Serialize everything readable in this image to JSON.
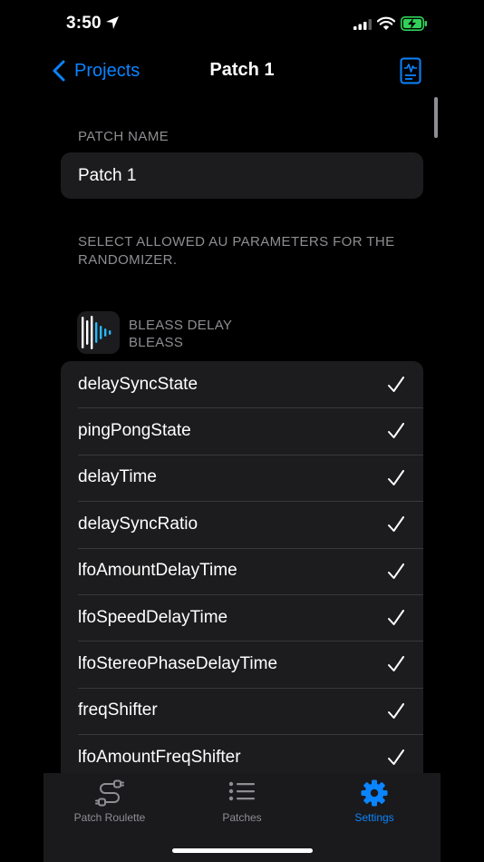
{
  "status_bar": {
    "time": "3:50"
  },
  "nav": {
    "back_label": "Projects",
    "title": "Patch 1"
  },
  "patch_name_section": {
    "header": "PATCH NAME",
    "value": "Patch 1"
  },
  "randomizer_section": {
    "header": "SELECT ALLOWED AU PARAMETERS FOR THE RANDOMIZER."
  },
  "plugin": {
    "name": "BLEASS DELAY",
    "vendor": "BLEASS"
  },
  "parameters": [
    {
      "label": "delaySyncState",
      "checked": true
    },
    {
      "label": "pingPongState",
      "checked": true
    },
    {
      "label": "delayTime",
      "checked": true
    },
    {
      "label": "delaySyncRatio",
      "checked": true
    },
    {
      "label": "lfoAmountDelayTime",
      "checked": true
    },
    {
      "label": "lfoSpeedDelayTime",
      "checked": true
    },
    {
      "label": "lfoStereoPhaseDelayTime",
      "checked": true
    },
    {
      "label": "freqShifter",
      "checked": true
    },
    {
      "label": "lfoAmountFreqShifter",
      "checked": true
    }
  ],
  "tabs": [
    {
      "label": "Patch Roulette",
      "icon": "roulette-icon",
      "active": false
    },
    {
      "label": "Patches",
      "icon": "list-icon",
      "active": false
    },
    {
      "label": "Settings",
      "icon": "gear-icon",
      "active": true
    }
  ],
  "colors": {
    "accent": "#0a84ff",
    "background": "#000000",
    "cell": "#1c1c1e",
    "secondary_text": "#8e8e93",
    "battery_charging": "#30d158"
  }
}
